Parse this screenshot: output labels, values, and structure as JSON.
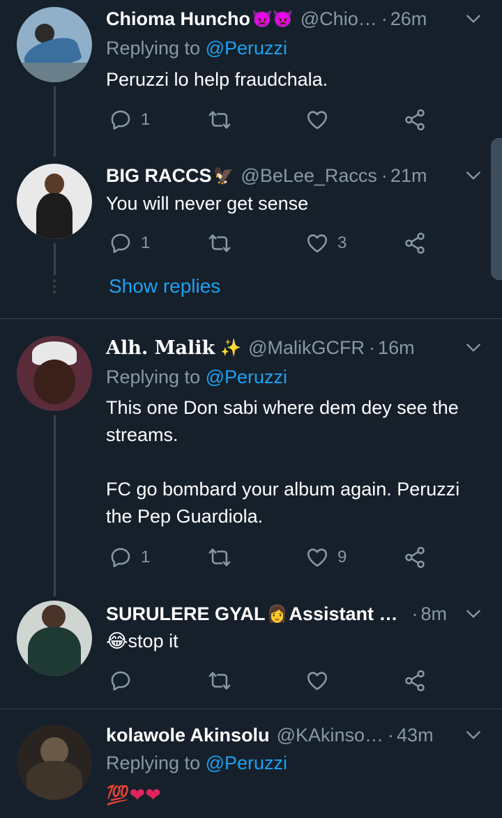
{
  "colors": {
    "background": "#15202b",
    "text_primary": "#ffffff",
    "text_secondary": "#8899a6",
    "accent": "#1da1f2",
    "divider": "#38444d"
  },
  "icons": {
    "reply": "reply-icon",
    "retweet": "retweet-icon",
    "like": "heart-icon",
    "share": "share-icon",
    "more": "chevron-down-icon"
  },
  "tweets": [
    {
      "name": "Chioma Huncho",
      "name_emoji": "👿👿",
      "handle": "@Chio…",
      "time": "26m",
      "reply_prefix": "Replying to ",
      "reply_mention": "@Peruzzi",
      "text": "Peruzzi lo help fraudchala.",
      "replies": "1",
      "retweets": "",
      "likes": ""
    },
    {
      "name": "BIG RACCS",
      "name_emoji": "🦅",
      "handle": "@BeLee_Raccs",
      "time": "21m",
      "text": "You will never get sense",
      "replies": "1",
      "retweets": "",
      "likes": "3",
      "show_replies": "Show replies"
    },
    {
      "name": "Alh. Malik",
      "name_emoji": "✨",
      "handle": "@MalikGCFR",
      "time": "16m",
      "reply_prefix": "Replying to ",
      "reply_mention": "@Peruzzi",
      "text": "This one Don sabi where dem dey see the streams.\n\nFC go bombard your album again. Peruzzi the Pep Guardiola.",
      "replies": "1",
      "retweets": "",
      "likes": "9"
    },
    {
      "name": "SURULERE GYAL",
      "name_emoji": "👩",
      "name_suffix": "Assistant …",
      "handle": "",
      "time": "8m",
      "text": "😂stop it",
      "replies": "",
      "retweets": "",
      "likes": ""
    },
    {
      "name": "kolawole Akinsolu",
      "name_emoji": "",
      "handle": "@KAkinso…",
      "time": "43m",
      "reply_prefix": "Replying to ",
      "reply_mention": "@Peruzzi",
      "text": "💯❤❤",
      "replies": "",
      "retweets": "",
      "likes": ""
    }
  ]
}
